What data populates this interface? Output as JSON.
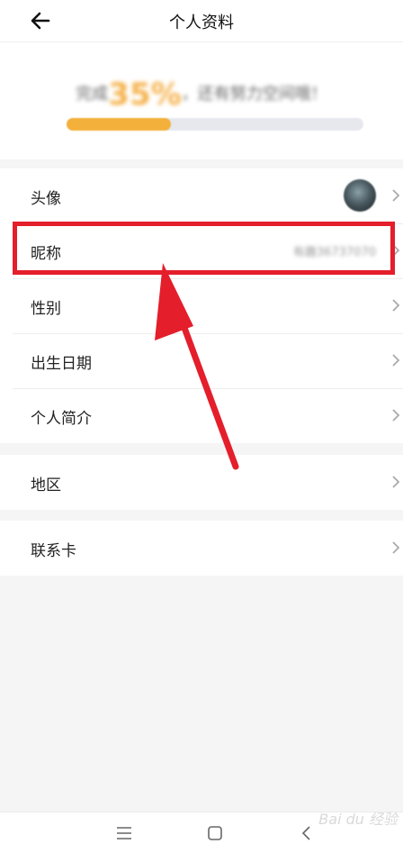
{
  "header": {
    "title": "个人资料"
  },
  "progress": {
    "text_prefix": "完成",
    "percent_text": "35%",
    "text_suffix": "，还有努力空间哦！",
    "value": 0.35
  },
  "items": {
    "avatar": "头像",
    "nickname": "昵称",
    "nickname_value": "有趣36737070",
    "gender": "性别",
    "birthday": "出生日期",
    "bio": "个人简介",
    "region": "地区",
    "contact": "联系卡"
  },
  "watermark": "Bai du 经验",
  "colors": {
    "highlight": "#e41e2b",
    "progress": "#f3b03a"
  }
}
